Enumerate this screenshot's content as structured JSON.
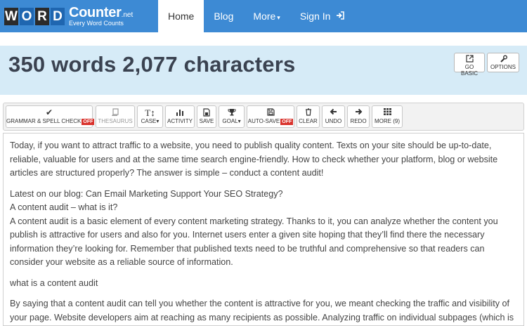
{
  "brand": {
    "letters": [
      "W",
      "O",
      "R",
      "D"
    ],
    "name": "Counter",
    "suffix": ".net",
    "tagline": "Every Word Counts"
  },
  "nav": {
    "items": [
      {
        "label": "Home",
        "active": true
      },
      {
        "label": "Blog"
      },
      {
        "label": "More",
        "caret": "▾"
      },
      {
        "label": "Sign In",
        "icon": "sign-in-icon"
      }
    ]
  },
  "counter": {
    "title": "350 words 2,077 characters"
  },
  "top_buttons": {
    "go_basic": "GO BASIC",
    "options": "OPTIONS"
  },
  "toolbar": {
    "grammar": "GRAMMAR & SPELL CHECK",
    "grammar_state": "OFF",
    "thesaurus": "THESAURUS",
    "case": "CASE",
    "activity": "ACTIVITY",
    "save": "SAVE",
    "goal": "GOAL",
    "autosave": "AUTO-SAVE",
    "autosave_state": "OFF",
    "clear": "CLEAR",
    "undo": "UNDO",
    "redo": "REDO",
    "more": "MORE (9)"
  },
  "editor": {
    "paragraphs": [
      "Today, if you want to attract traffic to a website, you need to publish quality content. Texts on your site should be up-to-date, reliable, valuable for users and at the same time search engine-friendly. How to check whether your platform, blog or website articles are structured properly? The answer is simple – conduct a content audit!",
      "Latest on our blog: Can Email Marketing Support Your SEO Strategy?",
      "A content audit – what is it?",
      "A content audit is a basic element of every content marketing strategy. Thanks to it, you can analyze whether the content you publish is attractive for users and also for you. Internet users enter a given site hoping that they’ll find there the necessary information they’re looking for. Remember that published texts need to be truthful and comprehensive so that readers can consider your website as a reliable source of information.",
      "what is a content audit",
      "By saying that a content audit can tell you whether the content is attractive for you, we meant checking the traffic and visibility of your page. Website developers aim at reaching as many recipients as possible. Analyzing traffic on individual subpages (which is one of"
    ]
  },
  "colors": {
    "nav_bg": "#3d8ad4",
    "panel_bg": "#d6ebf7",
    "off_badge": "#d9322c"
  }
}
